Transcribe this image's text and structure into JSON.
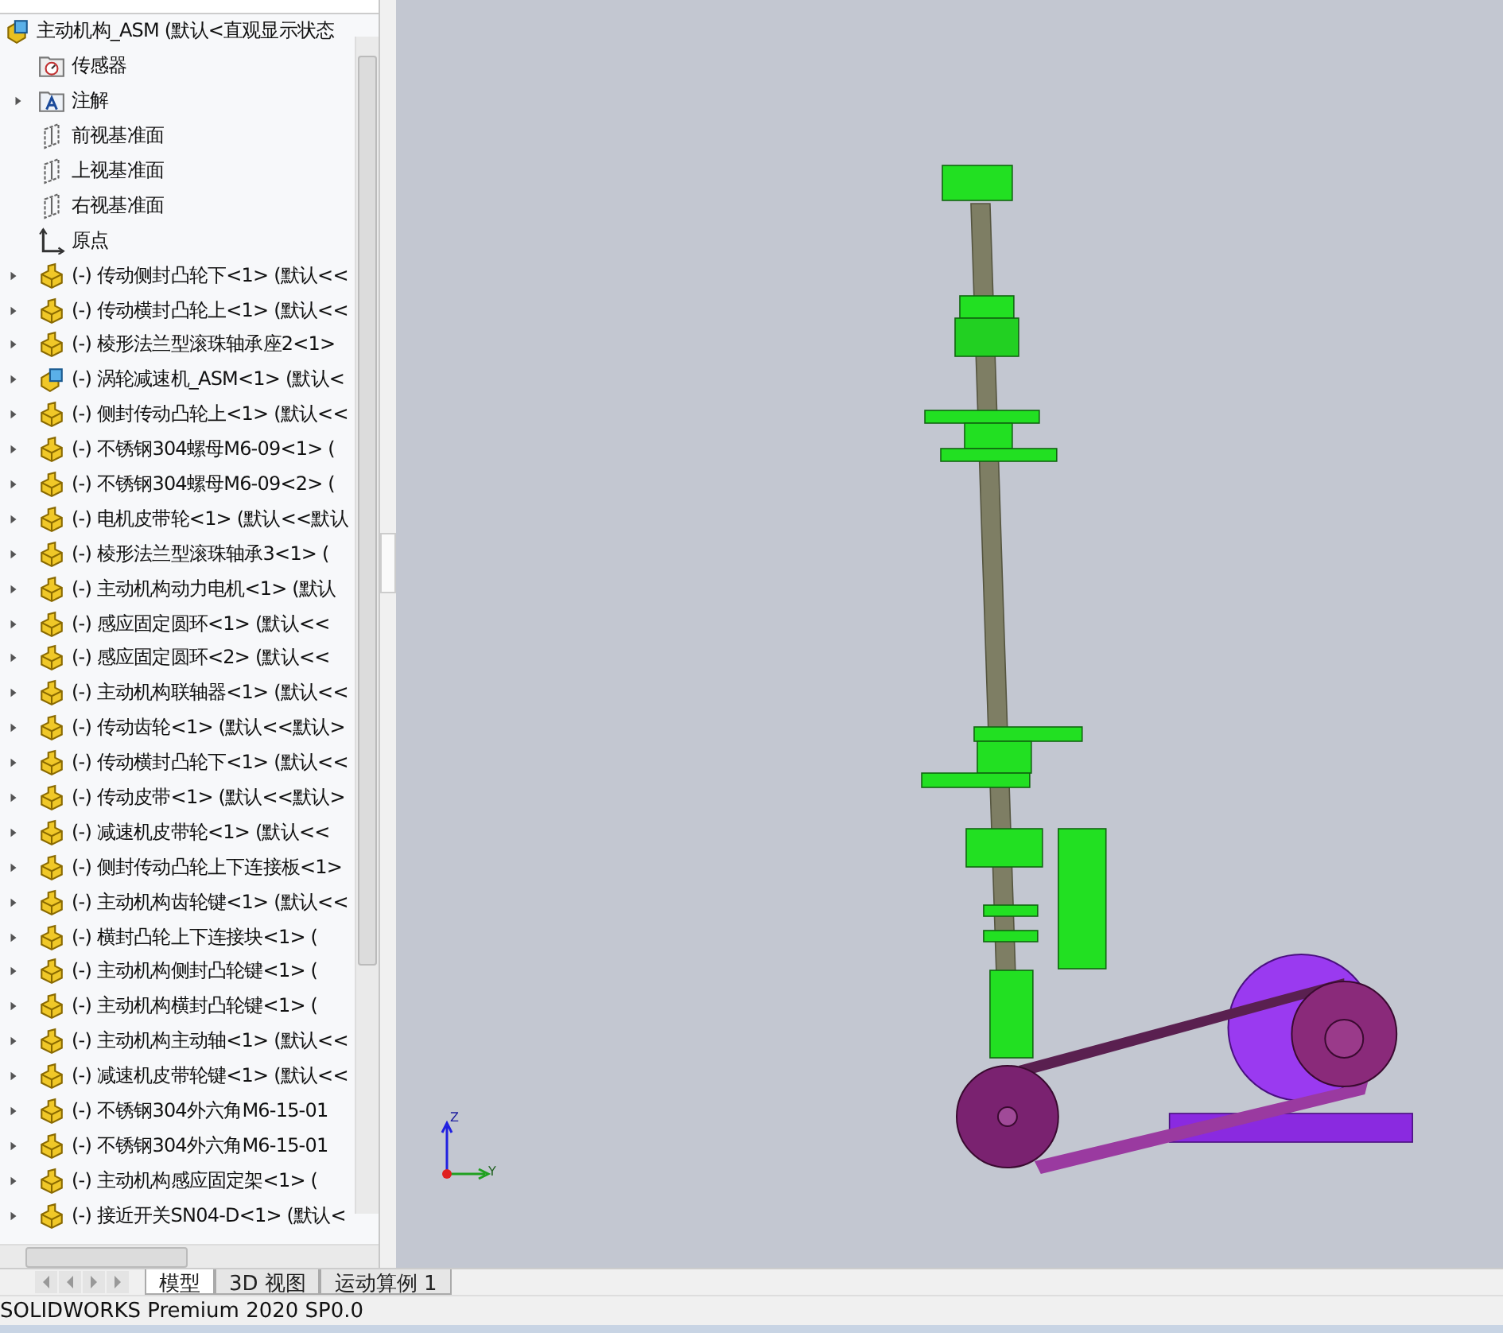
{
  "tree": {
    "root": {
      "label": "主动机构_ASM  (默认<直观显示状态",
      "kind": "assembly"
    },
    "items": [
      {
        "label": "传感器",
        "kind": "sensor"
      },
      {
        "label": "注解",
        "kind": "annotation",
        "expanded": false
      },
      {
        "label": "前视基准面",
        "kind": "plane"
      },
      {
        "label": "上视基准面",
        "kind": "plane"
      },
      {
        "label": "右视基准面",
        "kind": "plane"
      },
      {
        "label": "原点",
        "kind": "origin"
      },
      {
        "label": "(-) 传动侧封凸轮下<1> (默认<<",
        "kind": "part",
        "expanded": false
      },
      {
        "label": "(-) 传动横封凸轮上<1> (默认<<",
        "kind": "part",
        "expanded": false
      },
      {
        "label": "(-) 棱形法兰型滚珠轴承座2<1>",
        "kind": "part",
        "expanded": false
      },
      {
        "label": "(-) 涡轮减速机_ASM<1> (默认<",
        "kind": "assembly",
        "expanded": false
      },
      {
        "label": "(-) 侧封传动凸轮上<1> (默认<<",
        "kind": "part",
        "expanded": false
      },
      {
        "label": "(-) 不锈钢304螺母M6-09<1> (",
        "kind": "part",
        "expanded": false
      },
      {
        "label": "(-) 不锈钢304螺母M6-09<2> (",
        "kind": "part",
        "expanded": false
      },
      {
        "label": "(-) 电机皮带轮<1> (默认<<默认",
        "kind": "part",
        "expanded": false
      },
      {
        "label": "(-) 棱形法兰型滚珠轴承3<1> (",
        "kind": "part",
        "expanded": false
      },
      {
        "label": "(-) 主动机构动力电机<1> (默认",
        "kind": "part",
        "expanded": false
      },
      {
        "label": "(-) 感应固定圆环<1> (默认<<",
        "kind": "part",
        "expanded": false
      },
      {
        "label": "(-) 感应固定圆环<2> (默认<<",
        "kind": "part",
        "expanded": false
      },
      {
        "label": "(-) 主动机构联轴器<1> (默认<<",
        "kind": "part",
        "expanded": false
      },
      {
        "label": "(-) 传动齿轮<1> (默认<<默认>",
        "kind": "part",
        "expanded": false
      },
      {
        "label": "(-) 传动横封凸轮下<1> (默认<<",
        "kind": "part",
        "expanded": false
      },
      {
        "label": "(-) 传动皮带<1> (默认<<默认>",
        "kind": "part",
        "expanded": false
      },
      {
        "label": "(-) 减速机皮带轮<1> (默认<<",
        "kind": "part",
        "expanded": false
      },
      {
        "label": "(-) 侧封传动凸轮上下连接板<1>",
        "kind": "part",
        "expanded": false
      },
      {
        "label": "(-) 主动机构齿轮键<1> (默认<<",
        "kind": "part",
        "expanded": false
      },
      {
        "label": "(-) 横封凸轮上下连接块<1> (",
        "kind": "part",
        "expanded": false
      },
      {
        "label": "(-) 主动机构侧封凸轮键<1> (",
        "kind": "part",
        "expanded": false
      },
      {
        "label": "(-) 主动机构横封凸轮键<1> (",
        "kind": "part",
        "expanded": false
      },
      {
        "label": "(-) 主动机构主动轴<1> (默认<<",
        "kind": "part",
        "expanded": false
      },
      {
        "label": "(-) 减速机皮带轮键<1> (默认<<",
        "kind": "part",
        "expanded": false
      },
      {
        "label": "(-) 不锈钢304外六角M6-15-01",
        "kind": "part",
        "expanded": false
      },
      {
        "label": "(-) 不锈钢304外六角M6-15-01",
        "kind": "part",
        "expanded": false
      },
      {
        "label": "(-) 主动机构感应固定架<1> (",
        "kind": "part",
        "expanded": false
      },
      {
        "label": "(-) 接近开关SN04-D<1> (默认<",
        "kind": "part",
        "expanded": false
      }
    ]
  },
  "triad": {
    "z": "Z",
    "y": "Y"
  },
  "tabs": [
    {
      "label": "模型",
      "selected": true
    },
    {
      "label": "3D 视图",
      "selected": false
    },
    {
      "label": "运动算例 1",
      "selected": false
    }
  ],
  "status_bar": "SOLIDWORKS Premium 2020 SP0.0"
}
